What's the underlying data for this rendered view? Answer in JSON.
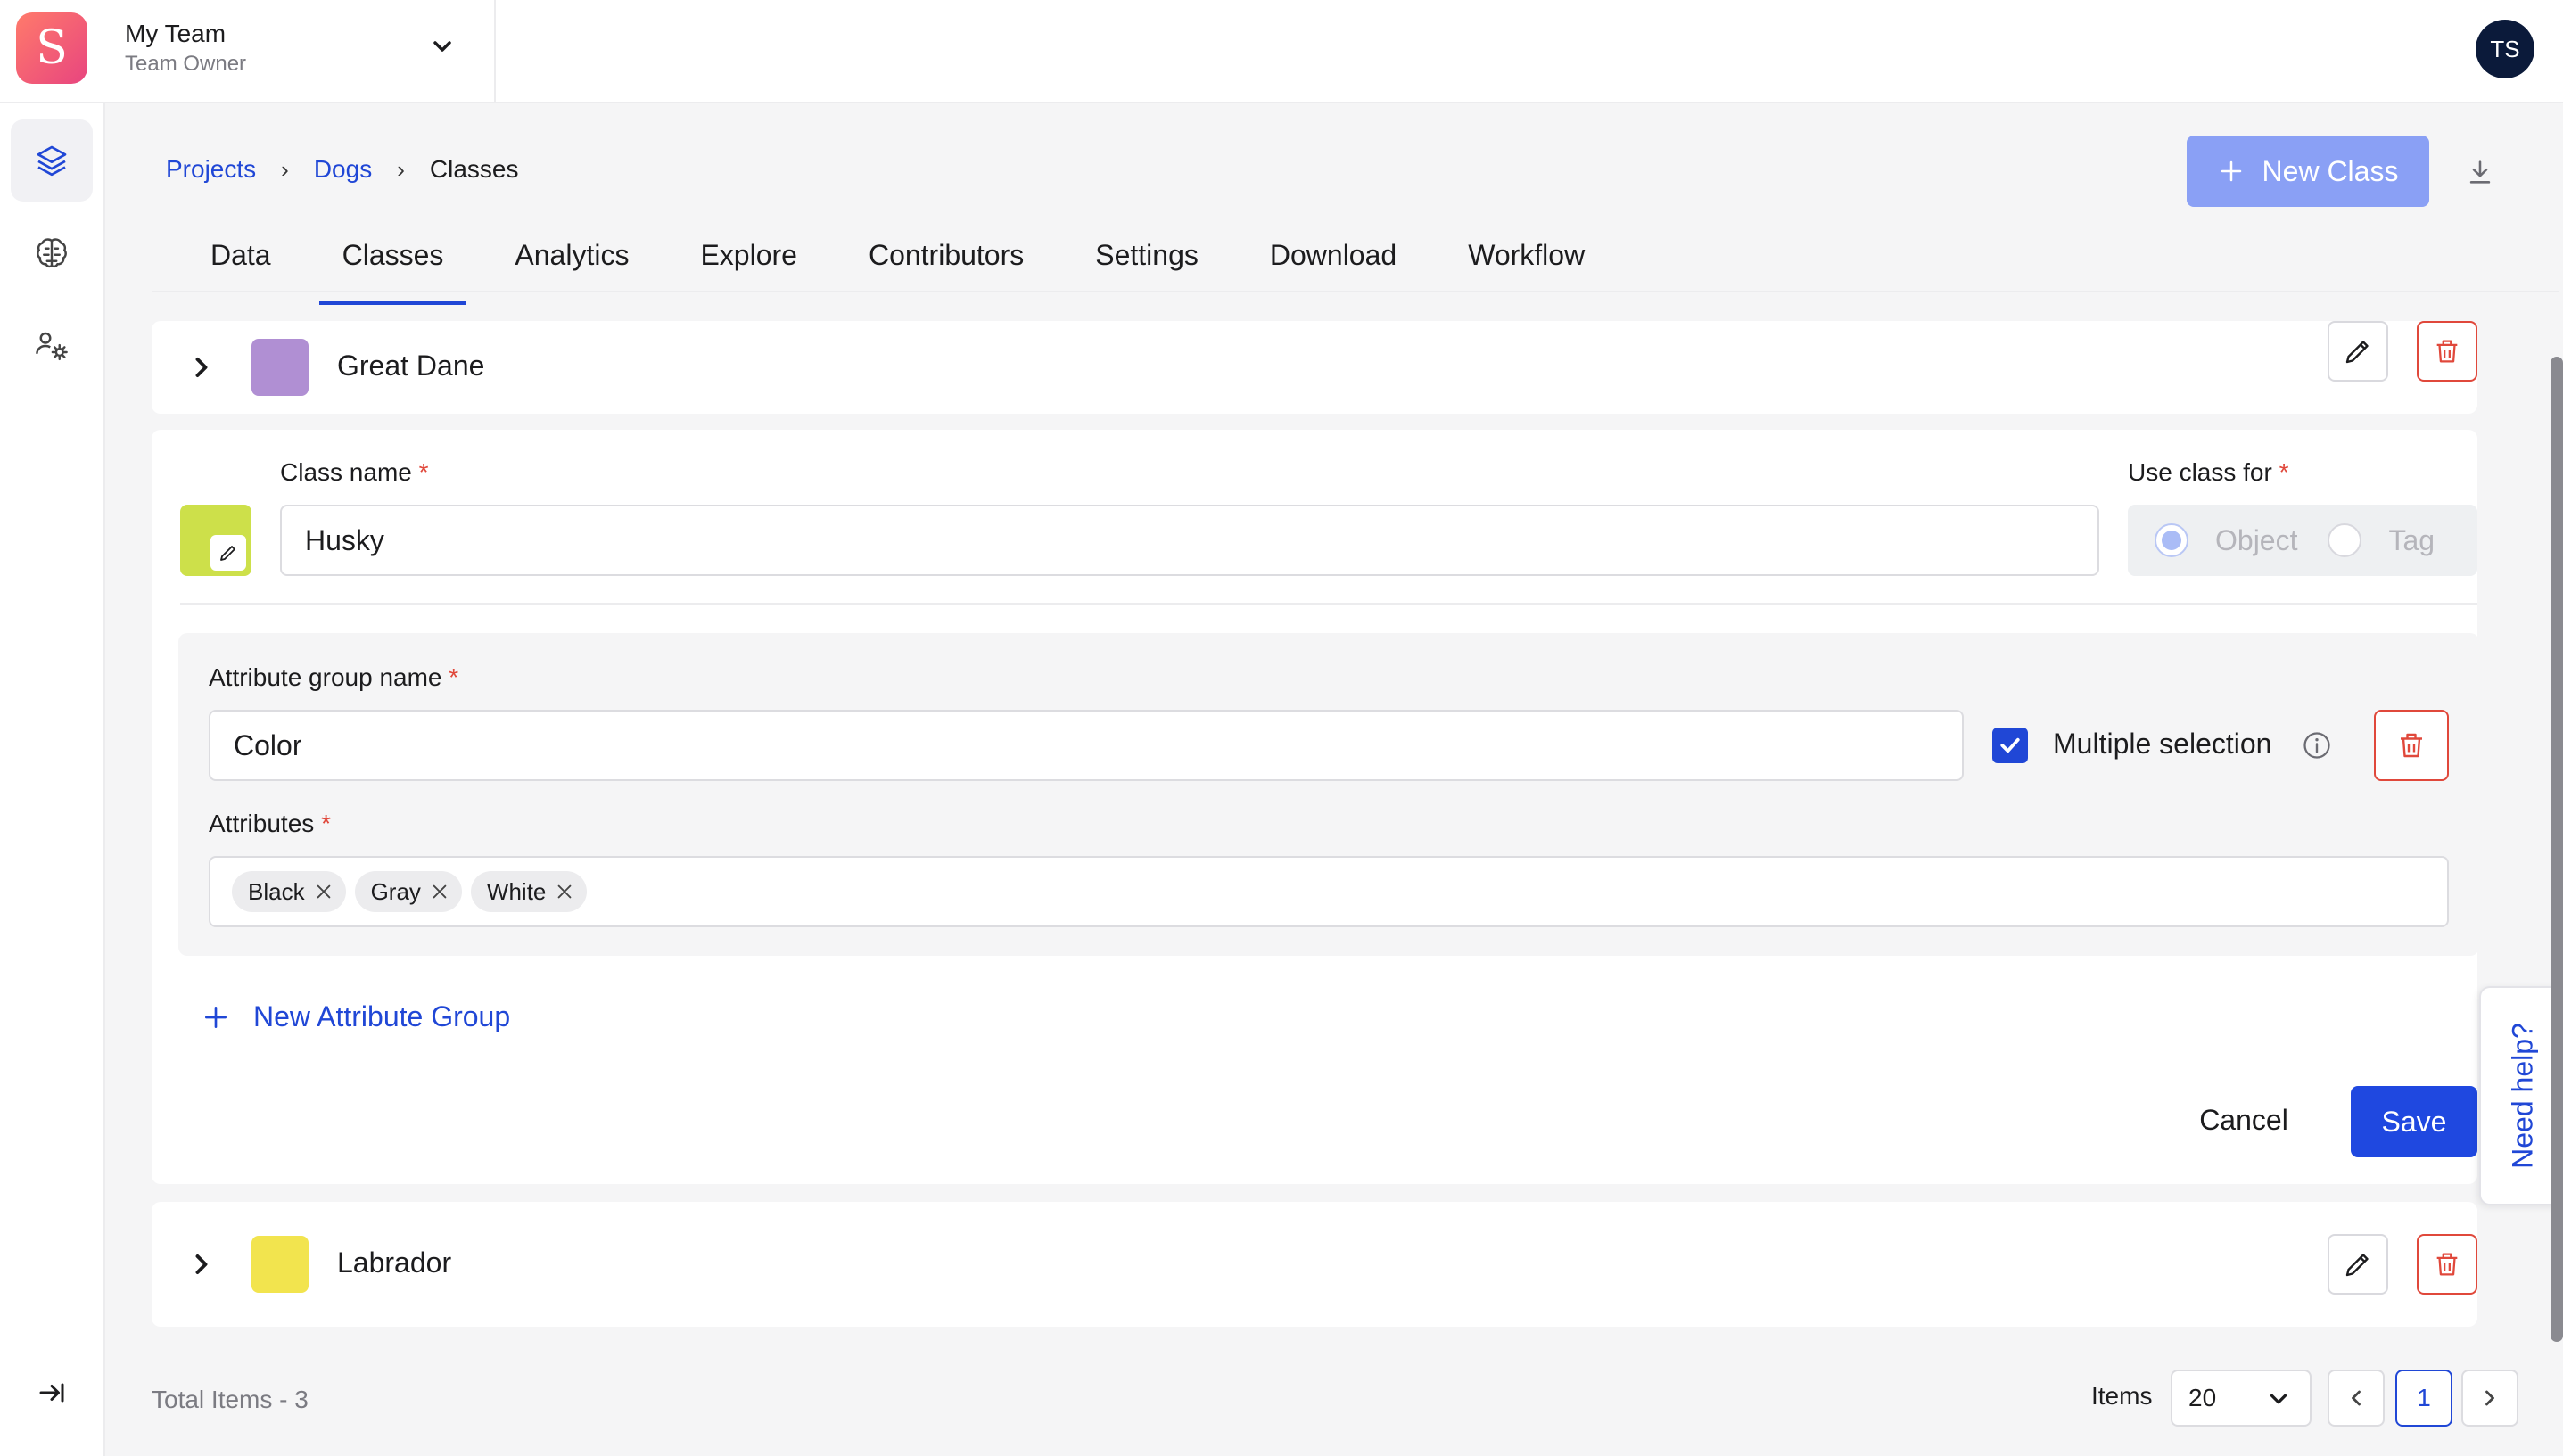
{
  "header": {
    "logo_letter": "S",
    "team_name": "My Team",
    "team_role": "Team Owner",
    "avatar_initials": "TS"
  },
  "sidebar": {
    "items": [
      {
        "icon": "layers-icon",
        "active": true
      },
      {
        "icon": "brain-icon",
        "active": false
      },
      {
        "icon": "users-settings-icon",
        "active": false
      }
    ],
    "collapse_icon": "collapse-sidebar-icon"
  },
  "breadcrumb": {
    "items": [
      "Projects",
      "Dogs"
    ],
    "current": "Classes"
  },
  "toolbar": {
    "new_class_label": "New Class"
  },
  "tabs": [
    {
      "label": "Data",
      "active": false
    },
    {
      "label": "Classes",
      "active": true
    },
    {
      "label": "Analytics",
      "active": false
    },
    {
      "label": "Explore",
      "active": false
    },
    {
      "label": "Contributors",
      "active": false
    },
    {
      "label": "Settings",
      "active": false
    },
    {
      "label": "Download",
      "active": false
    },
    {
      "label": "Workflow",
      "active": false
    }
  ],
  "classes": [
    {
      "name": "Great Dane",
      "color": "#b08fd3"
    },
    {
      "name": "Labrador",
      "color": "#f2e44e"
    }
  ],
  "editor": {
    "class_name_label": "Class name",
    "class_name_value": "Husky",
    "class_color": "#cde04a",
    "use_for_label": "Use class for",
    "use_for_options": [
      "Object",
      "Tag"
    ],
    "use_for_selected": "Object",
    "group": {
      "name_label": "Attribute group name",
      "name_value": "Color",
      "multiple_label": "Multiple selection",
      "multiple_checked": true,
      "attributes_label": "Attributes",
      "attributes": [
        "Black",
        "Gray",
        "White"
      ]
    },
    "new_group_label": "New Attribute Group",
    "cancel_label": "Cancel",
    "save_label": "Save",
    "required_mark": "*"
  },
  "help": {
    "label": "Need help?"
  },
  "footer": {
    "total_label": "Total Items - 3",
    "items_label": "Items",
    "page_size": "20",
    "current_page": "1"
  }
}
